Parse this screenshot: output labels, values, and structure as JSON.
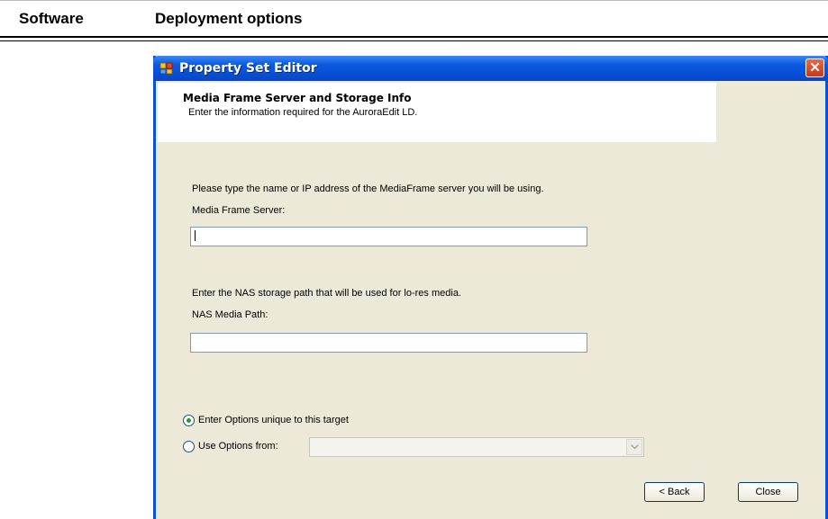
{
  "doc_header": {
    "section": "Software",
    "title": "Deployment options"
  },
  "window": {
    "title": "Property Set Editor",
    "close_symbol": "✕",
    "banner": {
      "heading": "Media Frame Server and Storage Info",
      "subtitle": "Enter the information required for the AuroraEdit LD."
    },
    "server": {
      "instruction": "Please type the name or IP address of the MediaFrame server you will be using.",
      "label": "Media Frame Server:",
      "value": ""
    },
    "nas": {
      "instruction": "Enter the NAS storage path that will be used for lo-res media.",
      "label": "NAS Media Path:",
      "value": ""
    },
    "options": [
      {
        "label": "Enter Options unique to this target",
        "selected": true
      },
      {
        "label": "Use Options from:",
        "selected": false
      }
    ],
    "use_options_combo": {
      "value": "",
      "enabled": false
    },
    "buttons": {
      "back": "< Back",
      "close": "Close"
    }
  },
  "icons": {
    "app": "property-set-app-icon",
    "close": "close-icon",
    "dropdown": "chevron-down-icon"
  },
  "colors": {
    "titlebar": "#0550d6",
    "window_bg": "#ece9d8",
    "close_button": "#d8532e",
    "radio_dot": "#21a121"
  }
}
